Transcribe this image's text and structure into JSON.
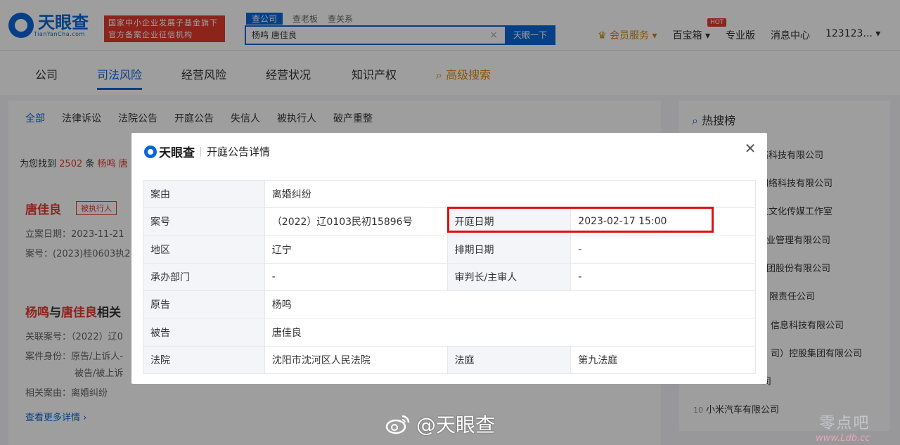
{
  "header": {
    "logo_text": "天眼查",
    "logo_sub": "TianYanCha.com",
    "badge_line1": "国家中小企业发展子基金旗下",
    "badge_line2": "官方备案企业征信机构",
    "search_tabs": [
      "查公司",
      "查老板",
      "查关系"
    ],
    "search_value": "杨鸣 唐佳良",
    "search_button": "天眼一下",
    "vip": "会员服务",
    "toolbox": "百宝箱",
    "hot_badge": "HOT",
    "pro": "专业版",
    "messages": "消息中心",
    "user": "123123..."
  },
  "nav": {
    "items": [
      "公司",
      "司法风险",
      "经营风险",
      "经营状况",
      "知识产权"
    ],
    "advanced": "高级搜索"
  },
  "sub_tabs": [
    "全部",
    "法律诉讼",
    "法院公告",
    "开庭公告",
    "失信人",
    "被执行人",
    "破产重整"
  ],
  "results": {
    "prefix": "为您找到",
    "count": "2502",
    "mid": "条",
    "term": "杨鸣 唐"
  },
  "card1": {
    "title": "唐佳良",
    "tag": "被执行人",
    "line1": "立案日期：2023-11-21",
    "line2": "案号：(2023)桂0603执2"
  },
  "card2": {
    "title_a": "杨鸣",
    "title_mid": "与",
    "title_b": "唐佳良",
    "title_rest": "相关",
    "line1": "关联案号：（2022）辽0",
    "line2": "案件身份：原告/上诉人-",
    "line3": "被告/被上诉",
    "line4": "相关案由：离婚纠纷",
    "more": "查看更多详情"
  },
  "hot_list": {
    "title": "热搜榜",
    "items": [
      "络科技有限公司",
      "网络科技有限公司",
      "主文化传媒工作室",
      "业管理有限公司",
      "团股份有限公司",
      "限责任公司",
      "信息科技有限公司",
      "司）控股集团有限公司",
      "司",
      "小米汽车有限公司"
    ],
    "last_num": "10"
  },
  "modal": {
    "logo_text": "天眼查",
    "title": "开庭公告详情",
    "rows": [
      {
        "k1": "案由",
        "v1": "离婚纠纷"
      },
      {
        "k1": "案号",
        "v1": "（2022）辽0103民初15896号",
        "k2": "开庭日期",
        "v2": "2023-02-17 15:00"
      },
      {
        "k1": "地区",
        "v1": "辽宁",
        "k2": "排期日期",
        "v2": "-"
      },
      {
        "k1": "承办部门",
        "v1": "-",
        "k2": "审判长/主审人",
        "v2": "-"
      },
      {
        "k1": "原告",
        "v1": "杨鸣"
      },
      {
        "k1": "被告",
        "v1": "唐佳良"
      },
      {
        "k1": "法院",
        "v1": "沈阳市沈河区人民法院",
        "k2": "法庭",
        "v2": "第九法庭"
      }
    ]
  },
  "watermark": {
    "weibo": "@天眼查",
    "site_cn": "零点吧",
    "site_url": "www.Ldb.cc"
  },
  "colors": {
    "brand_blue": "#0a66d8",
    "highlight_red": "#e01010",
    "accent_red": "#e23a2e"
  }
}
